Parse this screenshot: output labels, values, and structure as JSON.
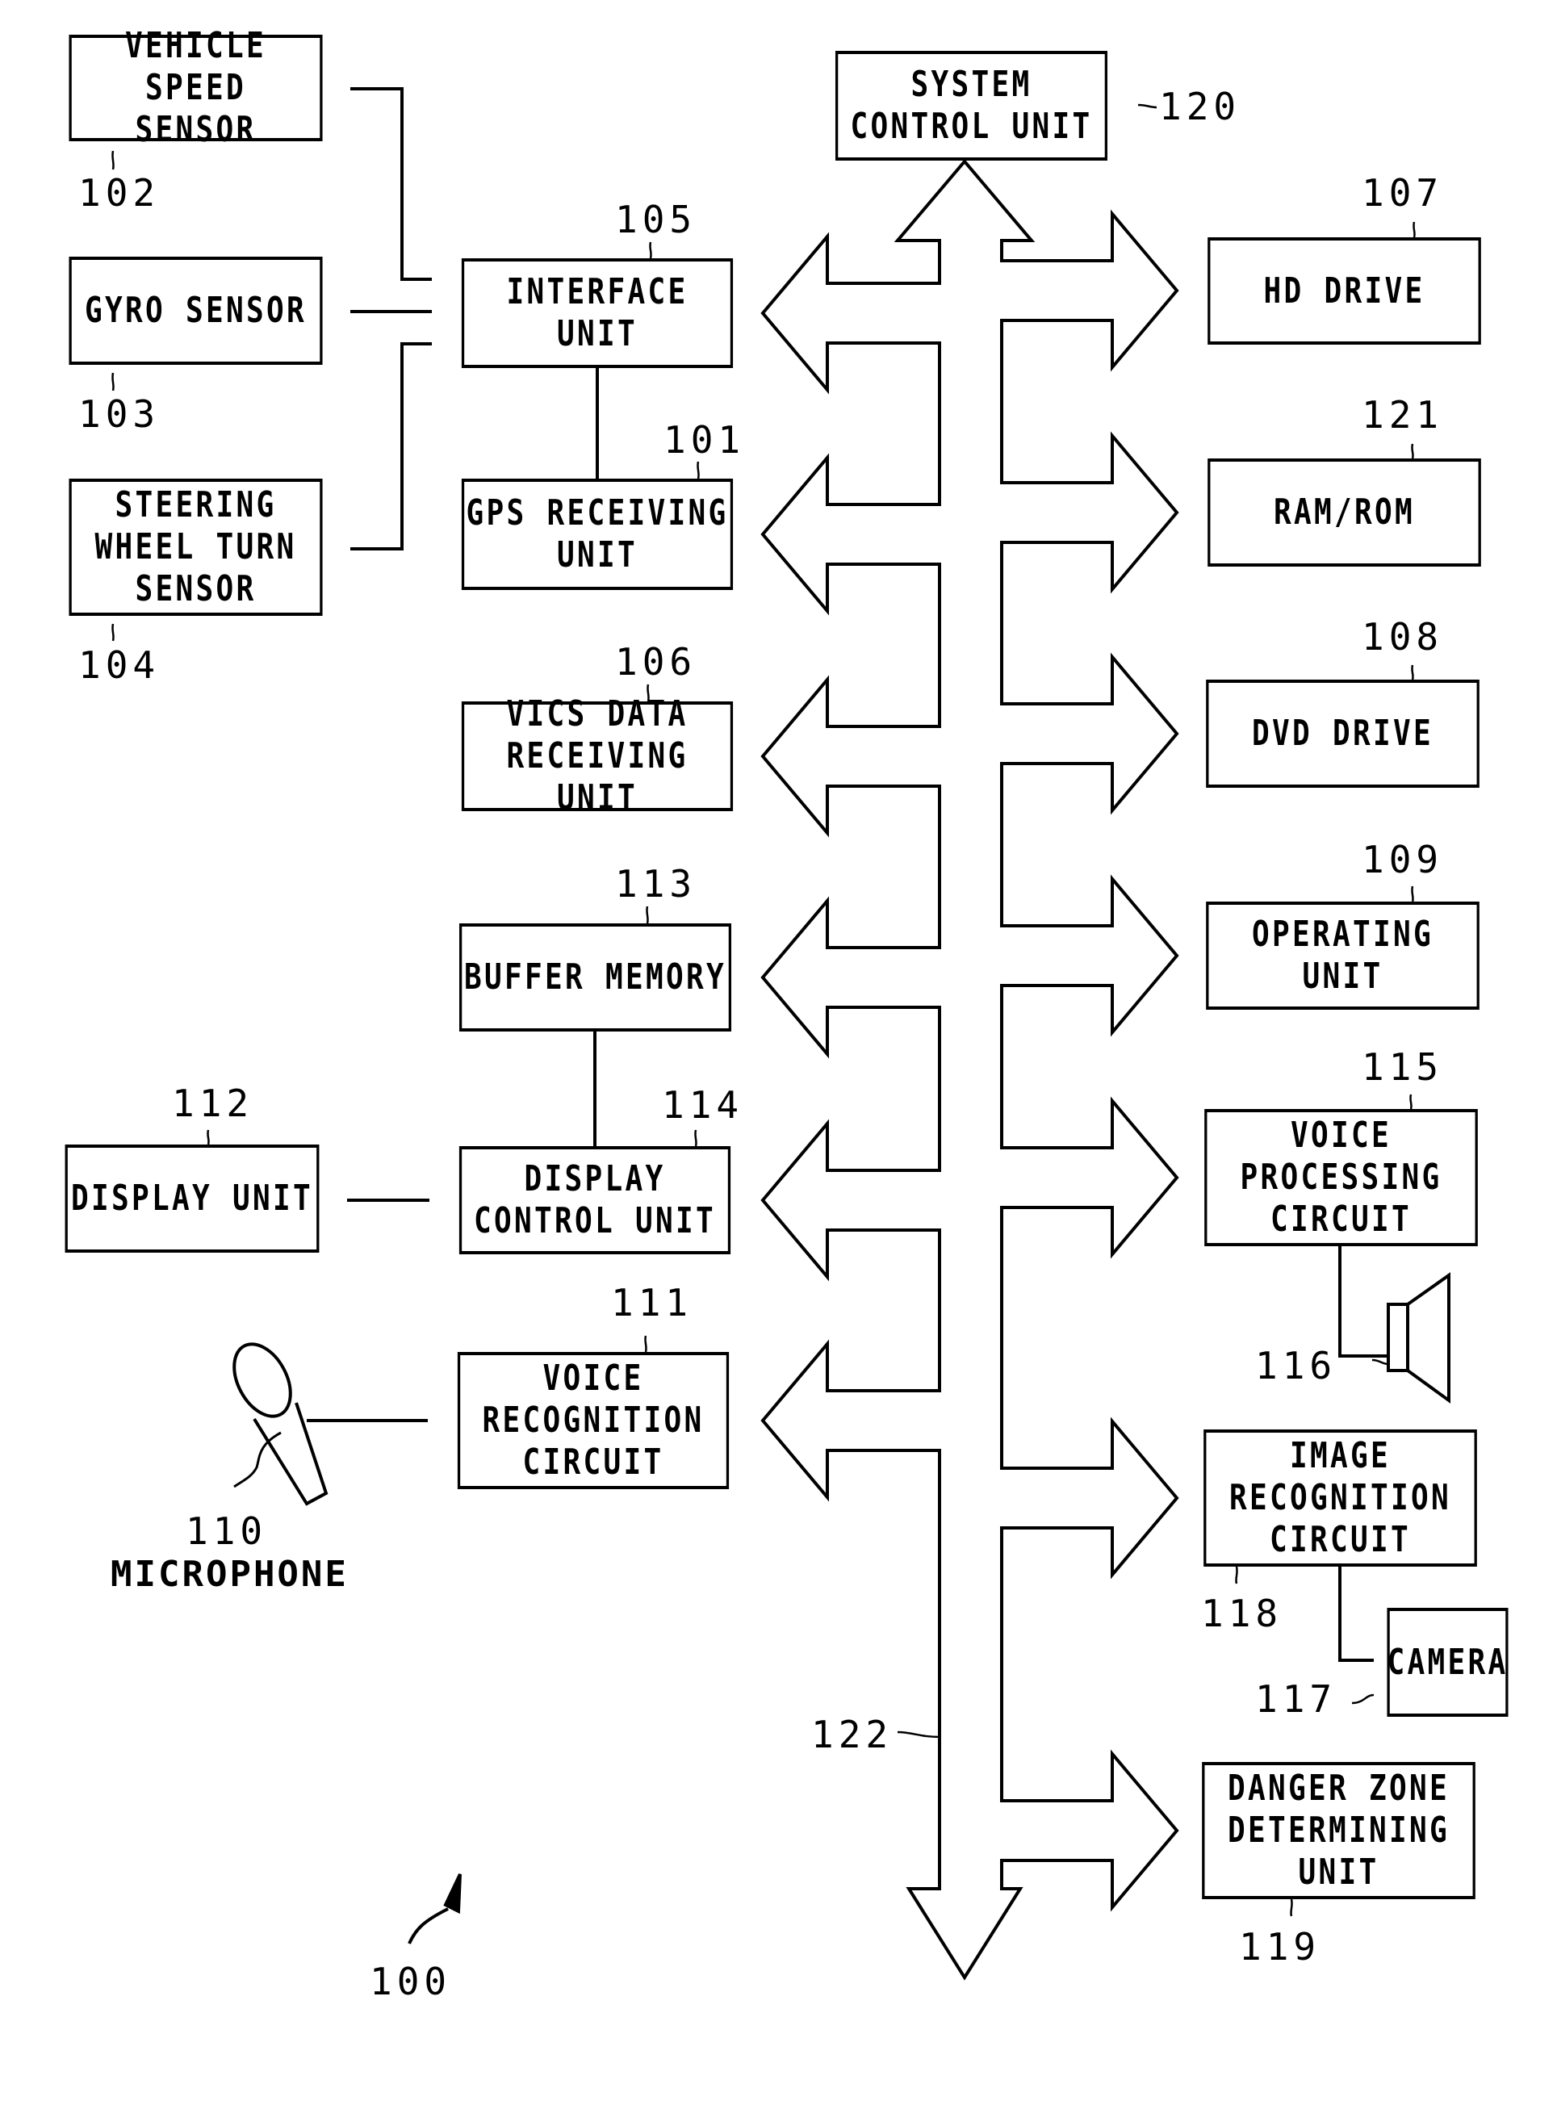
{
  "diagram": {
    "figure_ref": "100",
    "bus_ref": "122",
    "blocks": {
      "vehicle_speed_sensor": {
        "label": "VEHICLE SPEED\nSENSOR",
        "ref": "102"
      },
      "gyro_sensor": {
        "label": "GYRO SENSOR",
        "ref": "103"
      },
      "steering_sensor": {
        "label": "STEERING\nWHEEL TURN\nSENSOR",
        "ref": "104"
      },
      "interface_unit": {
        "label": "INTERFACE UNIT",
        "ref": "105"
      },
      "gps_receiving_unit": {
        "label": "GPS RECEIVING\nUNIT",
        "ref": "101"
      },
      "vics_unit": {
        "label": "VICS DATA\nRECEIVING UNIT",
        "ref": "106"
      },
      "buffer_memory": {
        "label": "BUFFER MEMORY",
        "ref": "113"
      },
      "display_control_unit": {
        "label": "DISPLAY\nCONTROL UNIT",
        "ref": "114"
      },
      "display_unit": {
        "label": "DISPLAY UNIT",
        "ref": "112"
      },
      "voice_recognition_circuit": {
        "label": "VOICE\nRECOGNITION\nCIRCUIT",
        "ref": "111"
      },
      "system_control_unit": {
        "label": "SYSTEM\nCONTROL UNIT",
        "ref": "120"
      },
      "hd_drive": {
        "label": "HD DRIVE",
        "ref": "107"
      },
      "ram_rom": {
        "label": "RAM/ROM",
        "ref": "121"
      },
      "dvd_drive": {
        "label": "DVD DRIVE",
        "ref": "108"
      },
      "operating_unit": {
        "label": "OPERATING\nUNIT",
        "ref": "109"
      },
      "voice_processing_circuit": {
        "label": "VOICE\nPROCESSING\nCIRCUIT",
        "ref": "115"
      },
      "image_recognition_circuit": {
        "label": "IMAGE\nRECOGNITION\nCIRCUIT",
        "ref": "118"
      },
      "camera": {
        "label": "CAMERA",
        "ref": "117"
      },
      "danger_zone_unit": {
        "label": "DANGER ZONE\nDETERMINING\nUNIT",
        "ref": "119"
      }
    },
    "speaker": {
      "ref": "116"
    },
    "microphone": {
      "ref": "110",
      "label": "MICROPHONE"
    }
  }
}
